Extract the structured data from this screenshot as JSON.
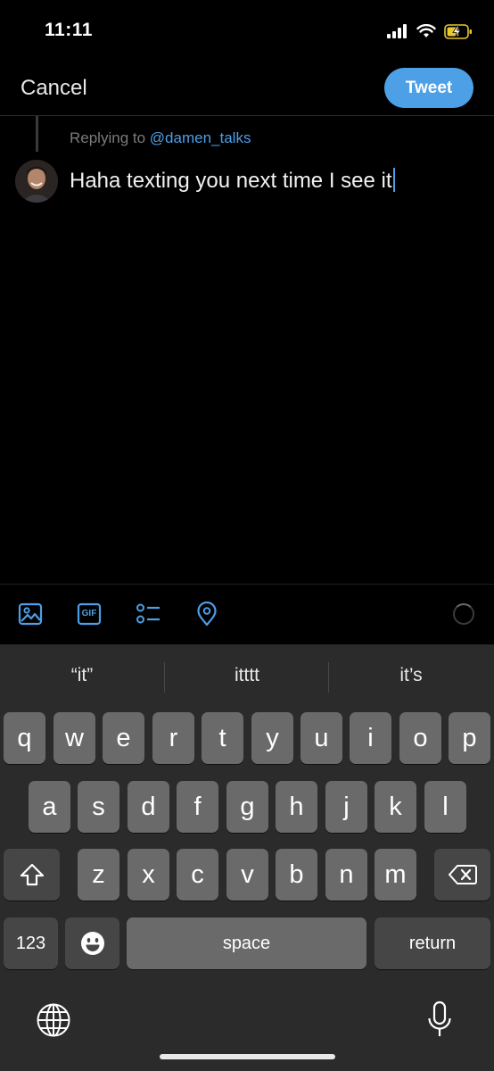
{
  "status_bar": {
    "time": "11:11"
  },
  "header": {
    "cancel_label": "Cancel",
    "tweet_label": "Tweet"
  },
  "reply": {
    "prefix": "Replying to",
    "handle": "@damen_talks",
    "text": "Haha texting you next time I see it"
  },
  "toolbar": {
    "icons": [
      "image-icon",
      "gif-icon",
      "poll-icon",
      "location-icon"
    ],
    "gif_label": "GIF"
  },
  "keyboard": {
    "suggestions": [
      "“it”",
      "itttt",
      "it’s"
    ],
    "row1": [
      "q",
      "w",
      "e",
      "r",
      "t",
      "y",
      "u",
      "i",
      "o",
      "p"
    ],
    "row2": [
      "a",
      "s",
      "d",
      "f",
      "g",
      "h",
      "j",
      "k",
      "l"
    ],
    "row3": [
      "z",
      "x",
      "c",
      "v",
      "b",
      "n",
      "m"
    ],
    "numbers_label": "123",
    "space_label": "space",
    "return_label": "return"
  },
  "colors": {
    "accent": "#4d9fe6",
    "background": "#000000",
    "keyboard": "#2b2b2b",
    "key": "#6a6a6a"
  }
}
